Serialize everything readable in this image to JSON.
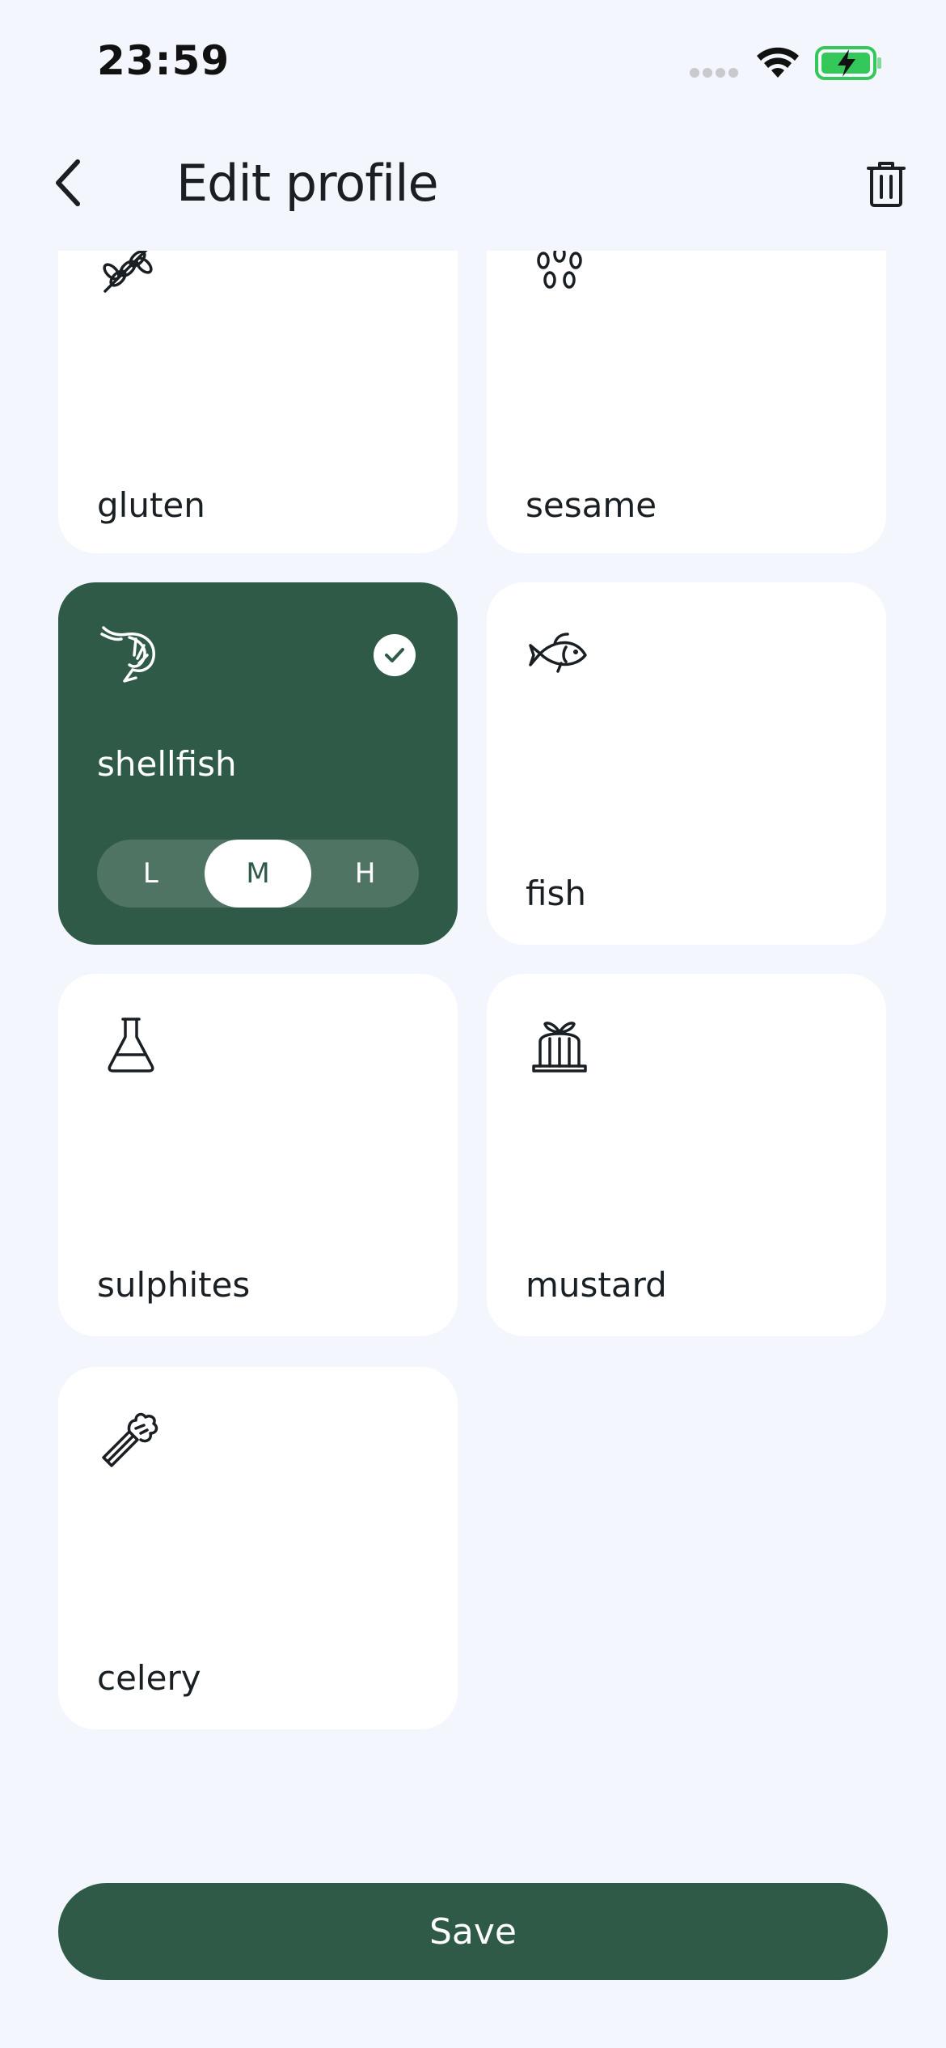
{
  "status_bar": {
    "time": "23:59",
    "battery_color": "#34c759"
  },
  "header": {
    "title": "Edit profile",
    "back_icon": "chevron-left-icon",
    "delete_icon": "trash-icon"
  },
  "allergens": [
    {
      "label": "gluten",
      "icon": "wheat-icon",
      "selected": false
    },
    {
      "label": "sesame",
      "icon": "sesame-seeds-icon",
      "selected": false
    },
    {
      "label": "shellfish",
      "icon": "shrimp-icon",
      "selected": true,
      "level": "M"
    },
    {
      "label": "fish",
      "icon": "fish-icon",
      "selected": false
    },
    {
      "label": "sulphites",
      "icon": "flask-icon",
      "selected": false
    },
    {
      "label": "mustard",
      "icon": "mustard-pot-icon",
      "selected": false
    },
    {
      "label": "celery",
      "icon": "celery-icon",
      "selected": false
    }
  ],
  "levels": [
    "L",
    "M",
    "H"
  ],
  "save_label": "Save",
  "colors": {
    "accent": "#2e5a47",
    "background": "#f3f7fd",
    "card": "#ffffff"
  }
}
